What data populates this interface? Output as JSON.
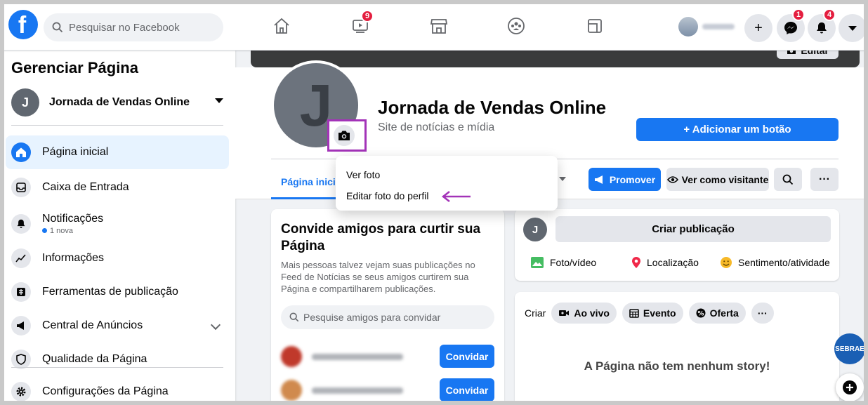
{
  "topbar": {
    "search_placeholder": "Pesquisar no Facebook",
    "video_badge": "9",
    "messenger_badge": "1",
    "notifications_badge": "4",
    "plus_symbol": "+"
  },
  "sidebar": {
    "title": "Gerenciar Página",
    "page_name": "Jornada de Vendas Online",
    "page_initial": "J",
    "items": [
      {
        "label": "Página inicial",
        "icon": "home-icon"
      },
      {
        "label": "Caixa de Entrada",
        "icon": "inbox-icon"
      },
      {
        "label": "Notificações",
        "sub": "1 nova",
        "icon": "bell-icon"
      },
      {
        "label": "Informações",
        "icon": "insights-icon"
      },
      {
        "label": "Ferramentas de publicação",
        "icon": "publishing-tools-icon"
      },
      {
        "label": "Central de Anúncios",
        "icon": "megaphone-icon"
      },
      {
        "label": "Qualidade da Página",
        "icon": "shield-icon"
      },
      {
        "label": "Configurações da Página",
        "icon": "gear-icon"
      }
    ]
  },
  "cover": {
    "edit_label": "Editar"
  },
  "page_header": {
    "initial": "J",
    "name": "Jornada de Vendas Online",
    "category": "Site de notícias e mídia",
    "add_button": "+ Adicionar um botão",
    "active_tab": "Página inicial",
    "promote": "Promover",
    "view_as_visitor": "Ver como visitante",
    "more": "···"
  },
  "photo_menu": {
    "items": [
      "Ver foto",
      "Editar foto do perfil"
    ]
  },
  "invite_card": {
    "title": "Convide amigos para curtir sua Página",
    "text": "Mais pessoas talvez vejam suas publicações no Feed de Notícias se seus amigos curtirem sua Página e compartilharem publicações.",
    "search_placeholder": "Pesquise amigos para convidar",
    "invite_label": "Convidar"
  },
  "composer": {
    "initial": "J",
    "create_post": "Criar publicação",
    "actions": [
      "Foto/vídeo",
      "Localização",
      "Sentimento/atividade"
    ]
  },
  "create_card": {
    "label": "Criar",
    "live": "Ao vivo",
    "event": "Evento",
    "offer": "Oferta",
    "more": "···",
    "no_story": "A Página não tem nenhum story!"
  },
  "floating": {
    "sebrae": "SEBRAE"
  },
  "colors": {
    "accent": "#1877f2",
    "highlight": "#a333b8",
    "badge": "#e41e3f"
  }
}
